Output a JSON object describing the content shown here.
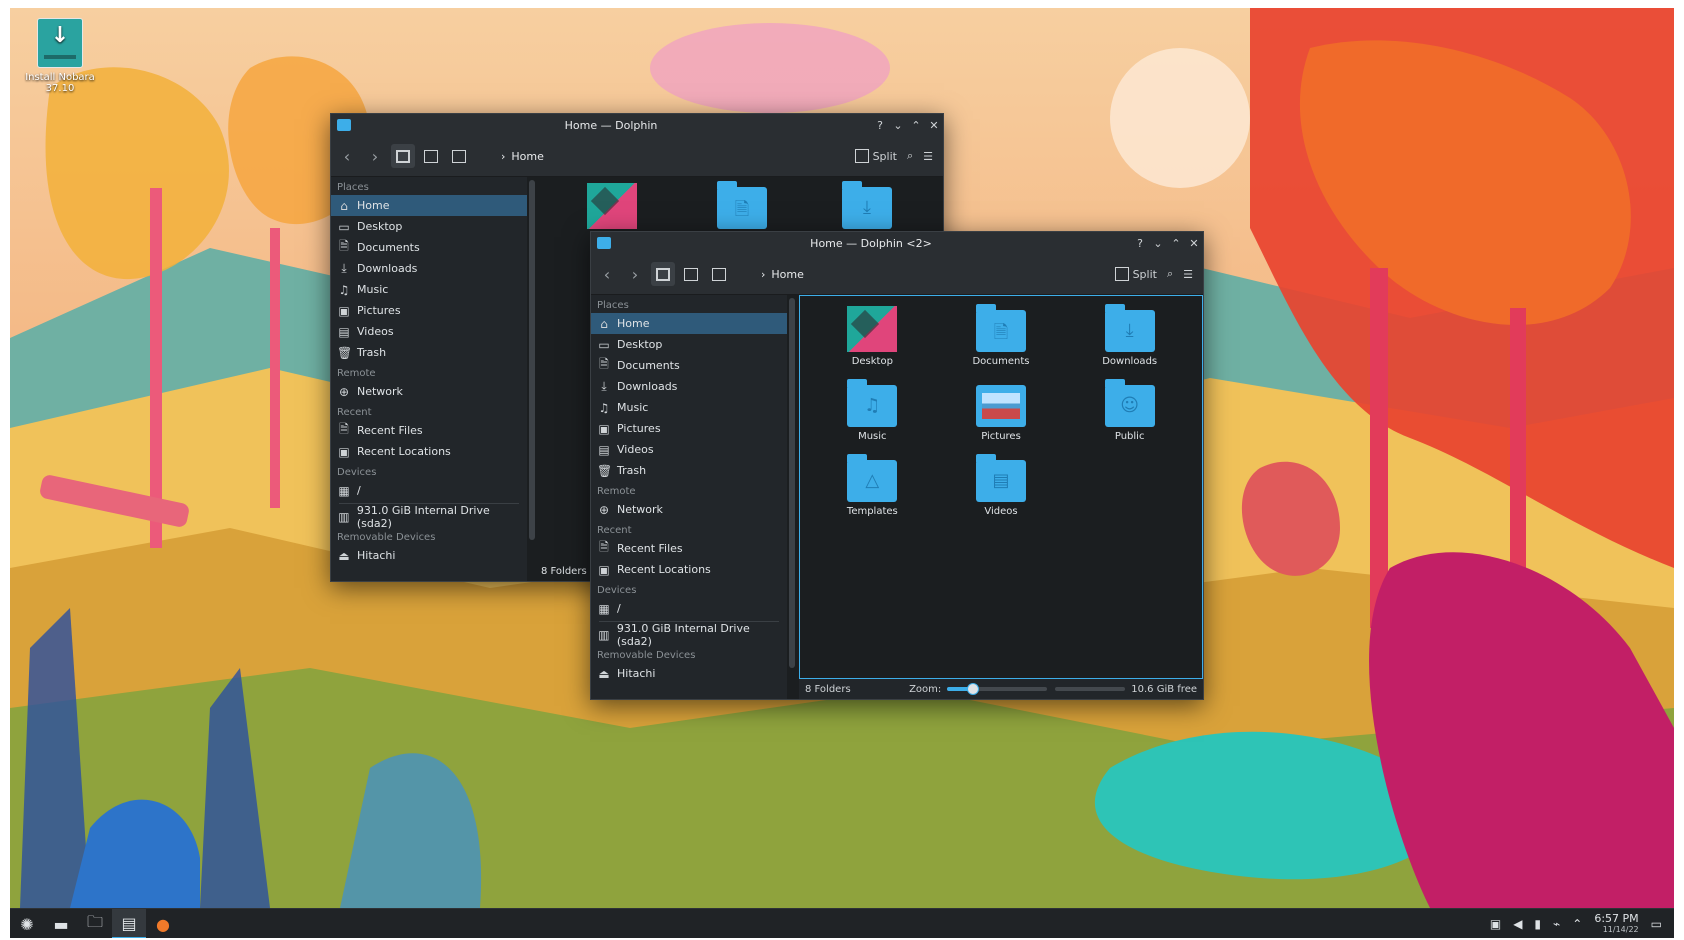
{
  "desktop": {
    "icon_label": "Install Nobara 37.10"
  },
  "window_back": {
    "title": "Home — Dolphin",
    "breadcrumb": "Home",
    "split_label": "Split",
    "status_text": "8 Folders",
    "places_header": "Places",
    "places": [
      {
        "label": "Home",
        "icon": "⌂",
        "name": "home-icon"
      },
      {
        "label": "Desktop",
        "icon": "▭",
        "name": "desktop-icon"
      },
      {
        "label": "Documents",
        "icon": "🗎",
        "name": "documents-icon"
      },
      {
        "label": "Downloads",
        "icon": "⤓",
        "name": "downloads-icon"
      },
      {
        "label": "Music",
        "icon": "♫",
        "name": "music-icon"
      },
      {
        "label": "Pictures",
        "icon": "▣",
        "name": "pictures-icon"
      },
      {
        "label": "Videos",
        "icon": "▤",
        "name": "videos-icon"
      },
      {
        "label": "Trash",
        "icon": "🗑",
        "name": "trash-icon"
      }
    ],
    "remote_header": "Remote",
    "remote": [
      {
        "label": "Network",
        "icon": "⊕",
        "name": "network-icon"
      }
    ],
    "recent_header": "Recent",
    "recent": [
      {
        "label": "Recent Files",
        "icon": "🗎",
        "name": "recent-files-icon"
      },
      {
        "label": "Recent Locations",
        "icon": "▣",
        "name": "recent-locations-icon"
      }
    ],
    "devices_header": "Devices",
    "devices": [
      {
        "label": "/",
        "icon": "▦",
        "name": "root-drive-icon"
      },
      {
        "label": "931.0 GiB Internal Drive (sda2)",
        "icon": "▥",
        "name": "internal-drive-icon"
      }
    ],
    "removable_header": "Removable Devices",
    "removable": [
      {
        "label": "Hitachi",
        "icon": "⏏",
        "name": "removable-drive-icon"
      }
    ]
  },
  "window_front": {
    "title": "Home — Dolphin <2>",
    "breadcrumb": "Home",
    "split_label": "Split",
    "status_text": "8 Folders",
    "zoom_label": "Zoom:",
    "zoom_fraction": 0.25,
    "free_space": "10.6 GiB free",
    "places_header": "Places",
    "places": [
      {
        "label": "Home",
        "icon": "⌂",
        "name": "home-icon"
      },
      {
        "label": "Desktop",
        "icon": "▭",
        "name": "desktop-icon"
      },
      {
        "label": "Documents",
        "icon": "🗎",
        "name": "documents-icon"
      },
      {
        "label": "Downloads",
        "icon": "⤓",
        "name": "downloads-icon"
      },
      {
        "label": "Music",
        "icon": "♫",
        "name": "music-icon"
      },
      {
        "label": "Pictures",
        "icon": "▣",
        "name": "pictures-icon"
      },
      {
        "label": "Videos",
        "icon": "▤",
        "name": "videos-icon"
      },
      {
        "label": "Trash",
        "icon": "🗑",
        "name": "trash-icon"
      }
    ],
    "remote_header": "Remote",
    "remote": [
      {
        "label": "Network",
        "icon": "⊕",
        "name": "network-icon"
      }
    ],
    "recent_header": "Recent",
    "recent": [
      {
        "label": "Recent Files",
        "icon": "🗎",
        "name": "recent-files-icon"
      },
      {
        "label": "Recent Locations",
        "icon": "▣",
        "name": "recent-locations-icon"
      }
    ],
    "devices_header": "Devices",
    "devices": [
      {
        "label": "/",
        "icon": "▦",
        "name": "root-drive-icon"
      },
      {
        "label": "931.0 GiB Internal Drive (sda2)",
        "icon": "▥",
        "name": "internal-drive-icon"
      }
    ],
    "removable_header": "Removable Devices",
    "removable": [
      {
        "label": "Hitachi",
        "icon": "⏏",
        "name": "removable-drive-icon"
      }
    ],
    "folders": [
      {
        "label": "Desktop",
        "kind": "desktop",
        "glyph": ""
      },
      {
        "label": "Documents",
        "kind": "folder",
        "glyph": "🗎"
      },
      {
        "label": "Downloads",
        "kind": "folder",
        "glyph": "⤓"
      },
      {
        "label": "Music",
        "kind": "folder",
        "glyph": "♫"
      },
      {
        "label": "Pictures",
        "kind": "picture",
        "glyph": ""
      },
      {
        "label": "Public",
        "kind": "folder",
        "glyph": "☺"
      },
      {
        "label": "Templates",
        "kind": "folder",
        "glyph": "△"
      },
      {
        "label": "Videos",
        "kind": "folder",
        "glyph": "▤"
      }
    ]
  },
  "taskbar": {
    "time": "6:57 PM",
    "date": "11/14/22"
  },
  "colors": {
    "accent": "#3daee9",
    "selection": "#2f5a7a",
    "window_bg": "#1b1e20",
    "toolbar_bg": "#2a2e32",
    "taskbar_bg": "#202326"
  }
}
